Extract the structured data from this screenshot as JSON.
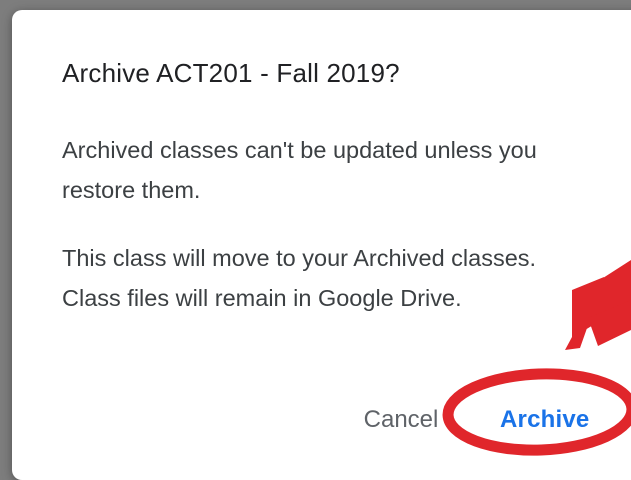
{
  "dialog": {
    "title": "Archive ACT201 - Fall 2019?",
    "paragraph1": "Archived classes can't be updated unless you restore them.",
    "paragraph2": "This class will move to your Archived classes. Class files will remain in Google Drive.",
    "cancel_label": "Cancel",
    "archive_label": "Archive"
  },
  "colors": {
    "backdrop": "#7d7d7d",
    "accent": "#1a73e8",
    "annotation": "#e0262b"
  }
}
